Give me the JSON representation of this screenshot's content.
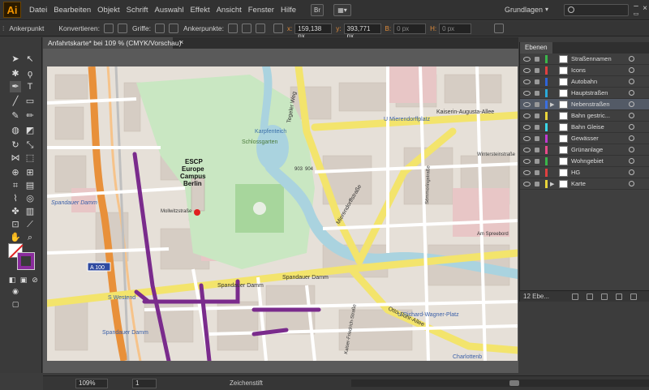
{
  "app": {
    "logo": "Ai",
    "workspace": "Grundlagen",
    "bridge_label": "Br"
  },
  "menu": [
    "Datei",
    "Bearbeiten",
    "Objekt",
    "Schrift",
    "Auswahl",
    "Effekt",
    "Ansicht",
    "Fenster",
    "Hilfe"
  ],
  "control": {
    "anchor_label": "Ankerpunkt",
    "convert_label": "Konvertieren:",
    "handles_label": "Griffe:",
    "anchors_label": "Ankerpunkte:",
    "x_label": "x:",
    "x_value": "159,138 px",
    "y_label": "y:",
    "y_value": "393,771 px",
    "w_label": "B:",
    "w_value": "0 px",
    "h_label": "H:",
    "h_value": "0 px"
  },
  "document": {
    "tab_title": "Anfahrtskarte* bei 109 % (CMYK/Vorschau)"
  },
  "status": {
    "zoom": "109%",
    "artboard": "1",
    "tool": "Zeichenstift"
  },
  "map": {
    "labels": {
      "escp": "ESCP",
      "europe": "Europe",
      "campus": "Campus",
      "berlin": "Berlin",
      "schlossgarten": "Schlossgarten",
      "karpfenteich": "Karpfenteich",
      "mierendorffplatz": "U Mierendorffplatz",
      "kaiserin_augusta": "Kaiserin-Augusta-Allee",
      "spandauer_damm_1": "Spandauer Damm",
      "spandauer_damm_2": "Spandauer Damm",
      "spandauer_damm_3": "Spandauer Damm",
      "spandauer_damm_4": "Spandauer Damm",
      "westend": "S Westend",
      "otto_suhr": "Otto-Suhr-Allee",
      "richard_wagner": "U Richard-Wagner-Platz",
      "a100": "A 100",
      "spreebord": "Am Spreebord",
      "tegeler_weg": "Tegeler Weg",
      "mierendorffstr": "Mierendorffstraße",
      "sommeringstr": "Sömmeringstraße",
      "wintersteinstr": "Wintersteinstraße",
      "kaiserdamm": "Kaiser-Friedrich-Straße",
      "charlottenburg": "Charlottenb",
      "mollwitzstr": "Mollwitzstraße",
      "num_903": "903",
      "num_904": "904"
    }
  },
  "layers": {
    "tab": "Ebenen",
    "count": "12 Ebe...",
    "items": [
      {
        "name": "Straßennamen",
        "color": "#3ab54a"
      },
      {
        "name": "Icons",
        "color": "#e04040"
      },
      {
        "name": "Autobahn",
        "color": "#2f63d8"
      },
      {
        "name": "Hauptstraßen",
        "color": "#2aa9d8"
      },
      {
        "name": "Nebenstraßen",
        "color": "#3a6fe0"
      },
      {
        "name": "Bahn gestric...",
        "color": "#e8d43a"
      },
      {
        "name": "Bahn Gleise",
        "color": "#3ad6e8"
      },
      {
        "name": "Gewässer",
        "color": "#c03ad0"
      },
      {
        "name": "Grünanlage",
        "color": "#e84a8a"
      },
      {
        "name": "Wohngebiet",
        "color": "#3ab54a"
      },
      {
        "name": "HG",
        "color": "#e04040"
      },
      {
        "name": "Karte",
        "color": "#e8d43a"
      }
    ]
  },
  "colors": {
    "accent_orange": "#f29400",
    "route_purple": "#7a2b8c",
    "main_road": "#f3e46c",
    "highway": "#e8903a",
    "water": "#aad3df",
    "park": "#c8e6c0",
    "building": "#d9d0c9"
  }
}
